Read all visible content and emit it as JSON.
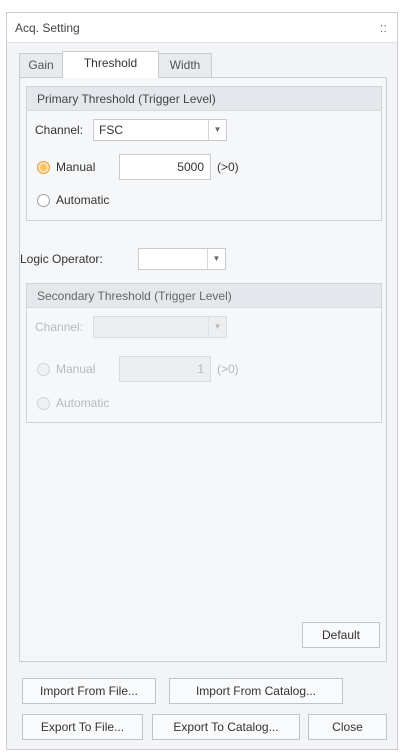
{
  "window": {
    "title": "Acq. Setting",
    "grip_icon": "::"
  },
  "tabs": [
    {
      "label": "Gain"
    },
    {
      "label": "Threshold"
    },
    {
      "label": "Width"
    }
  ],
  "primary": {
    "title": "Primary Threshold (Trigger Level)",
    "channel_label": "Channel:",
    "channel_value": "FSC",
    "manual_label": "Manual",
    "manual_value": "5000",
    "manual_hint": "(>0)",
    "automatic_label": "Automatic"
  },
  "logic": {
    "label": "Logic Operator:",
    "value": ""
  },
  "secondary": {
    "title": "Secondary Threshold (Trigger Level)",
    "channel_label": "Channel:",
    "channel_value": "",
    "manual_label": "Manual",
    "manual_value": "1",
    "manual_hint": "(>0)",
    "automatic_label": "Automatic"
  },
  "buttons": {
    "default": "Default",
    "import_file": "Import From File...",
    "import_catalog": "Import From Catalog...",
    "export_file": "Export To File...",
    "export_catalog": "Export To Catalog...",
    "close": "Close"
  },
  "colors": {
    "accent_radio": "#f7c36a",
    "panel_bg": "#f2f4f6"
  }
}
